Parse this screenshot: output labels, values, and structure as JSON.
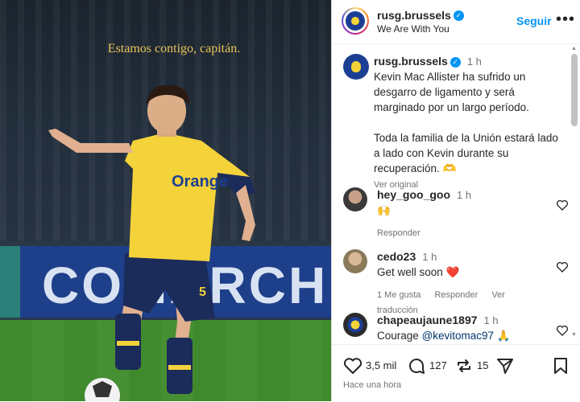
{
  "photo": {
    "caption": "Estamos contigo, capitán.",
    "banner_text": "COMARCH",
    "jersey_text": "Orange",
    "shorts_number": "5"
  },
  "header": {
    "username": "rusg.brussels",
    "subtitle": "We Are With You",
    "follow_label": "Seguir",
    "more_icon": "more-horizontal-icon"
  },
  "caption": {
    "username": "rusg.brussels",
    "time": "1 h",
    "paragraph1": "Kevin Mac Allister ha sufrido un desgarro de ligamento y será marginado por un largo período.",
    "paragraph2": "Toda la familia de la Unión estará lado a lado con Kevin durante su recuperación. 🫶",
    "see_translation": "Ver original"
  },
  "comments": [
    {
      "username": "hey_goo_goo",
      "time": "1 h",
      "text": "🙌",
      "actions": [
        "Responder"
      ]
    },
    {
      "username": "cedo23",
      "time": "1 h",
      "text": "Get well soon ❤️",
      "actions": [
        "1 Me gusta",
        "Responder",
        "Ver traducción"
      ]
    },
    {
      "username": "chapeaujaune1897",
      "time": "1 h",
      "text_prefix": "Courage",
      "mention": "@kevitomac97",
      "text_suffix": "🙏"
    }
  ],
  "stats": {
    "likes": "3,5 mil",
    "comments": "127",
    "reposts": "15",
    "posted": "Hace una hora"
  },
  "colors": {
    "link": "#0095f6",
    "jersey": "#f4d33a",
    "navy": "#1c3f94"
  }
}
